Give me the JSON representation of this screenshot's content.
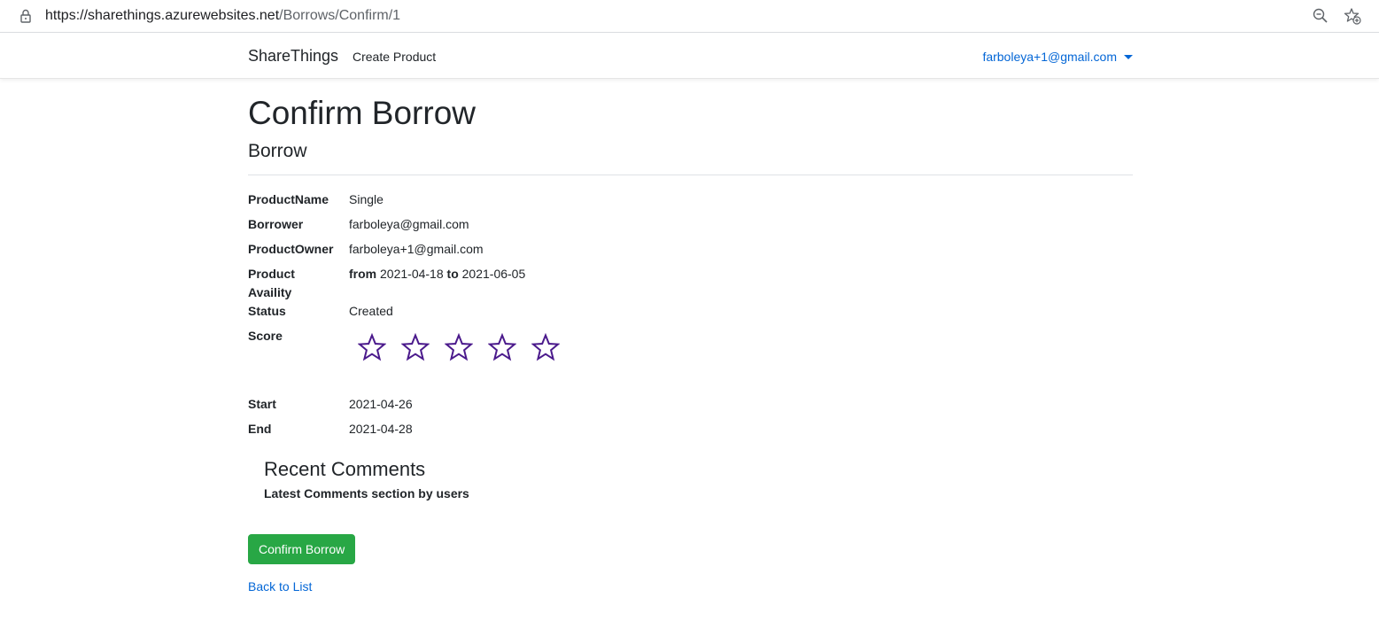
{
  "browser": {
    "url_host": "https://sharethings.azurewebsites.net",
    "url_path": "/Borrows/Confirm/1"
  },
  "navbar": {
    "brand": "ShareThings",
    "create_product": "Create Product",
    "user_email": "farboleya+1@gmail.com"
  },
  "page": {
    "title": "Confirm Borrow",
    "subtitle": "Borrow"
  },
  "details": {
    "product_name_label": "ProductName",
    "product_name_value": "Single",
    "borrower_label": "Borrower",
    "borrower_value": "farboleya@gmail.com",
    "product_owner_label": "ProductOwner",
    "product_owner_value": "farboleya+1@gmail.com",
    "availability_label_1": "Product",
    "availability_label_2": "Availity",
    "availability_from_word": "from",
    "availability_from": "2021-04-18",
    "availability_to_word": "to",
    "availability_to": "2021-06-05",
    "status_label": "Status",
    "status_value": "Created",
    "score_label": "Score",
    "score": {
      "value": 0,
      "max": 5,
      "star_color": "#4b1a8c"
    },
    "start_label": "Start",
    "start_value": "2021-04-26",
    "end_label": "End",
    "end_value": "2021-04-28"
  },
  "comments": {
    "title": "Recent Comments",
    "subtitle": "Latest Comments section by users"
  },
  "actions": {
    "confirm_label": "Confirm Borrow",
    "back_label": "Back to List"
  },
  "colors": {
    "link": "#0366d6",
    "success": "#28a745"
  }
}
